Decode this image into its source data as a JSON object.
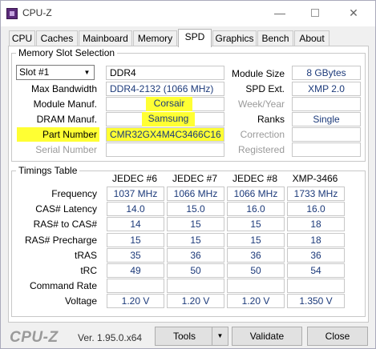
{
  "window": {
    "title": "CPU-Z",
    "minimize": "—",
    "close": "✕"
  },
  "tabs": [
    "CPU",
    "Caches",
    "Mainboard",
    "Memory",
    "SPD",
    "Graphics",
    "Bench",
    "About"
  ],
  "active_tab": "SPD",
  "slot_group": {
    "title": "Memory Slot Selection",
    "slot_selected": "Slot #1",
    "memory_type": "DDR4",
    "labels": {
      "max_bandwidth": "Max Bandwidth",
      "module_manuf": "Module Manuf.",
      "dram_manuf": "DRAM Manuf.",
      "part_number": "Part Number",
      "serial_number": "Serial Number",
      "module_size": "Module Size",
      "spd_ext": "SPD Ext.",
      "week_year": "Week/Year",
      "ranks": "Ranks",
      "correction": "Correction",
      "registered": "Registered"
    },
    "values": {
      "max_bandwidth": "DDR4-2132 (1066 MHz)",
      "module_manuf": "Corsair",
      "dram_manuf": "Samsung",
      "part_number": "CMR32GX4M4C3466C16",
      "serial_number": "",
      "module_size": "8 GBytes",
      "spd_ext": "XMP 2.0",
      "week_year": "",
      "ranks": "Single",
      "correction": "",
      "registered": ""
    },
    "highlight_color": "#ffff33"
  },
  "timings": {
    "title": "Timings Table",
    "columns": [
      "JEDEC #6",
      "JEDEC #7",
      "JEDEC #8",
      "XMP-3466"
    ],
    "rows": [
      {
        "label": "Frequency",
        "values": [
          "1037 MHz",
          "1066 MHz",
          "1066 MHz",
          "1733 MHz"
        ]
      },
      {
        "label": "CAS# Latency",
        "values": [
          "14.0",
          "15.0",
          "16.0",
          "16.0"
        ]
      },
      {
        "label": "RAS# to CAS#",
        "values": [
          "14",
          "15",
          "15",
          "18"
        ]
      },
      {
        "label": "RAS# Precharge",
        "values": [
          "15",
          "15",
          "15",
          "18"
        ]
      },
      {
        "label": "tRAS",
        "values": [
          "35",
          "36",
          "36",
          "36"
        ]
      },
      {
        "label": "tRC",
        "values": [
          "49",
          "50",
          "50",
          "54"
        ]
      },
      {
        "label": "Command Rate",
        "values": [
          "",
          "",
          "",
          ""
        ]
      },
      {
        "label": "Voltage",
        "values": [
          "1.20 V",
          "1.20 V",
          "1.20 V",
          "1.350 V"
        ]
      }
    ]
  },
  "footer": {
    "logo": "CPU-Z",
    "version": "Ver. 1.95.0.x64",
    "tools_label": "Tools",
    "validate_label": "Validate",
    "close_label": "Close"
  },
  "colors": {
    "value_text": "#1c3a7a",
    "accent": "#5a2a7a"
  }
}
